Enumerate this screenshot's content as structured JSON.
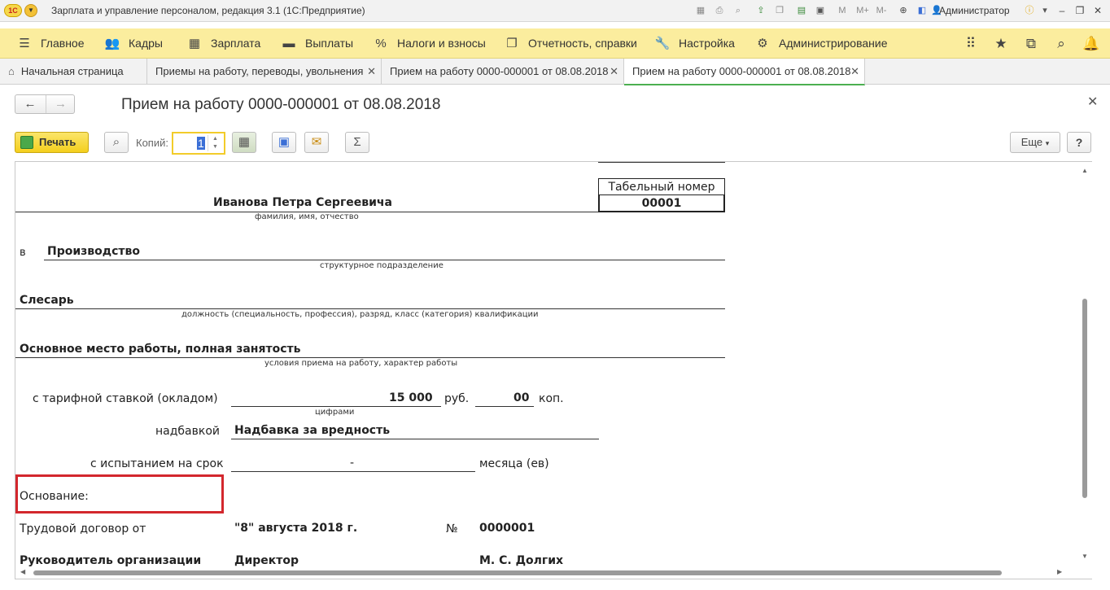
{
  "titlebar": {
    "logo": "1С",
    "title": "Зарплата и управление персоналом, редакция 3.1  (1С:Предприятие)",
    "memory_plus": "M+",
    "memory_minus": "M-",
    "memory": "M",
    "user": "Администратор"
  },
  "sections": [
    {
      "label": "Главное",
      "icon": "menu-icon"
    },
    {
      "label": "Кадры",
      "icon": "people-icon"
    },
    {
      "label": "Зарплата",
      "icon": "calculator-icon"
    },
    {
      "label": "Выплаты",
      "icon": "wallet-icon"
    },
    {
      "label": "Налоги и взносы",
      "icon": "percent-icon"
    },
    {
      "label": "Отчетность, справки",
      "icon": "reports-icon"
    },
    {
      "label": "Настройка",
      "icon": "wrench-icon"
    },
    {
      "label": "Администрирование",
      "icon": "gear-icon"
    }
  ],
  "tabs": [
    {
      "label": "Начальная страница"
    },
    {
      "label": "Приемы на работу, переводы, увольнения"
    },
    {
      "label": "Прием на работу 0000-000001 от 08.08.2018"
    },
    {
      "label": "Прием на работу 0000-000001 от 08.08.2018"
    }
  ],
  "form": {
    "title": "Прием на работу 0000-000001 от 08.08.2018",
    "print_label": "Печать",
    "copies_label": "Копий:",
    "copies_value": "1",
    "more_label": "Еще",
    "help_label": "?"
  },
  "document": {
    "tabel_header": "Табельный номер",
    "tabel_number": "00001",
    "employee_name": "Иванова Петра Сергеевича",
    "employee_caption": "фамилия, имя, отчество",
    "in_label": "в",
    "department": "Производство",
    "department_caption": "структурное подразделение",
    "position": "Слесарь",
    "position_caption": "должность (специальность, профессия), разряд, класс (категория) квалификации",
    "conditions": "Основное место работы, полная занятость",
    "conditions_caption": "условия приема на работу, характер работы",
    "rate_label": "с тарифной ставкой (окладом)",
    "rate_value": "15 000",
    "rub_label": "руб.",
    "kop_value": "00",
    "kop_label": "коп.",
    "digits_caption": "цифрами",
    "bonus_label": "надбавкой",
    "bonus_value": "Надбавка за вредность",
    "probation_label": "с испытанием на срок",
    "probation_value": "-",
    "months_label": "месяца (ев)",
    "basis_label": "Основание:",
    "contract_label": "Трудовой договор от",
    "contract_date": "\"8\" августа 2018 г.",
    "number_sign": "№",
    "contract_number": "0000001",
    "head_label": "Руководитель организации",
    "head_position": "Директор",
    "head_name": "М. С. Долгих"
  },
  "colors": {
    "section_panel": "#fbed9e",
    "print_button": "#f4cf1d",
    "highlight": "#d3272d",
    "active_tab_underline": "#4caf50"
  }
}
